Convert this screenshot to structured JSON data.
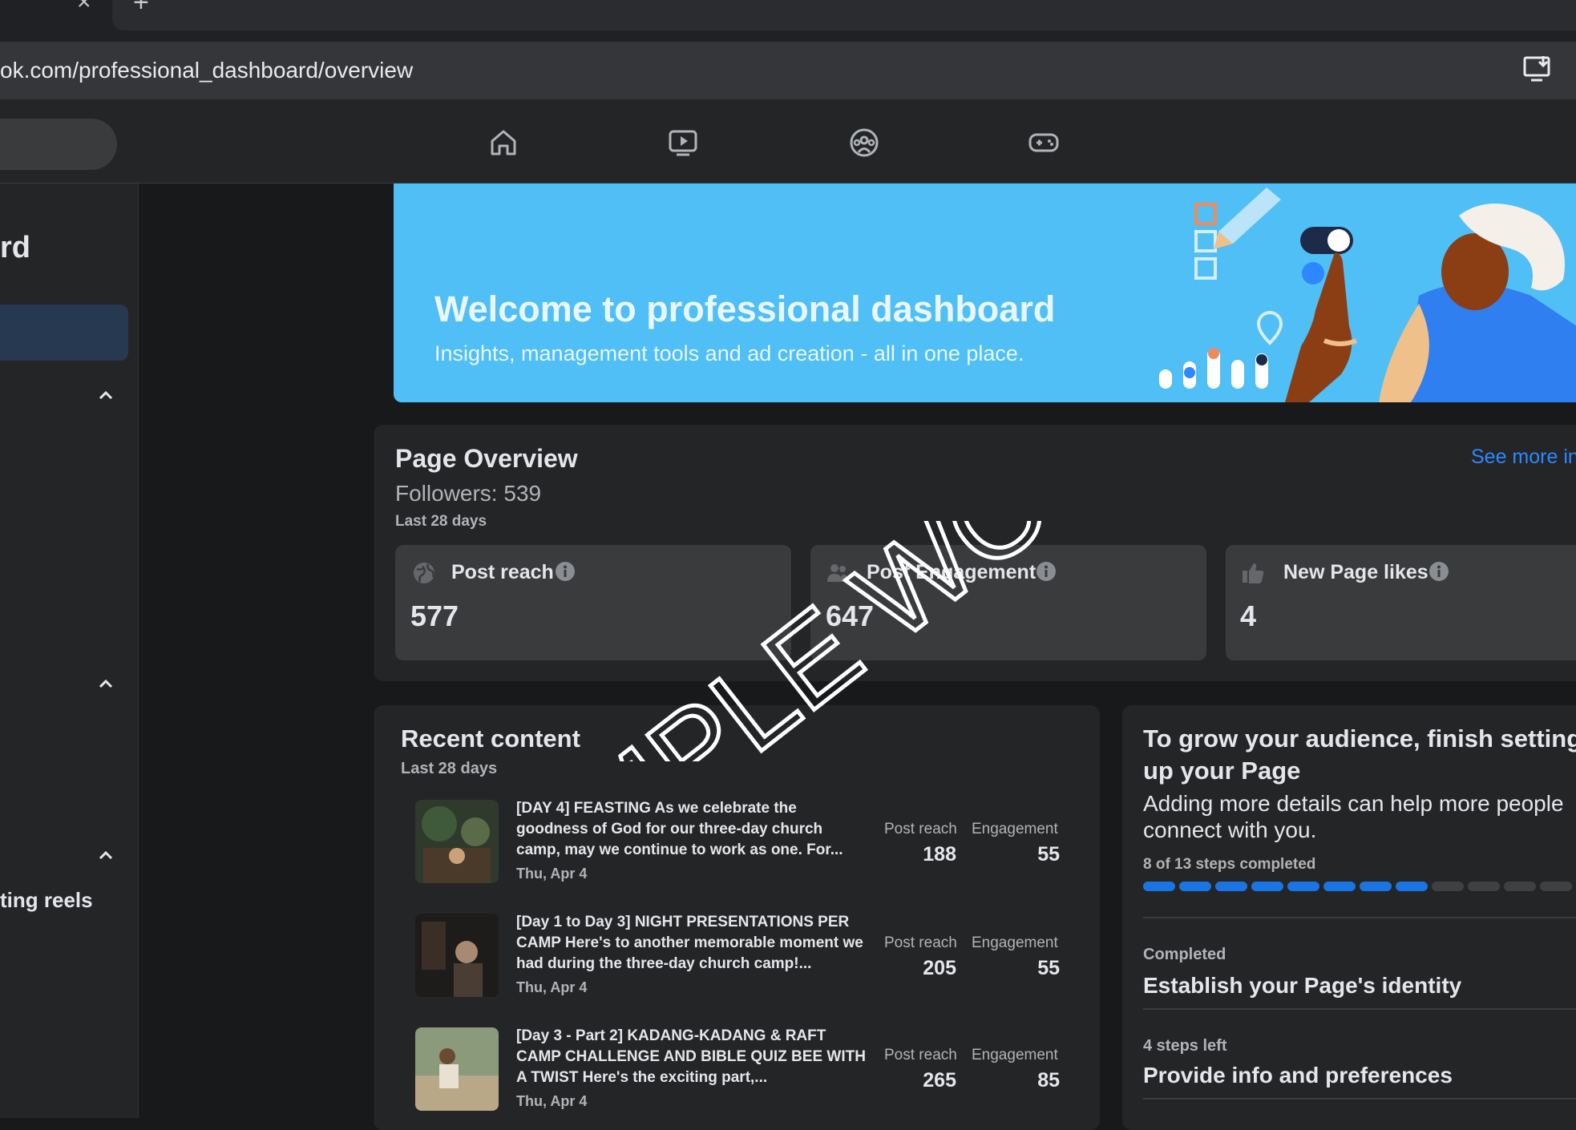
{
  "browser": {
    "tab_close": "×",
    "tab_new": "+",
    "url": "ok.com/professional_dashboard/overview"
  },
  "sidebar": {
    "title": "rd",
    "reels_item": "ting reels"
  },
  "banner": {
    "title": "Welcome to professional dashboard",
    "subtitle": "Insights, management tools and ad creation - all in one place."
  },
  "overview": {
    "title": "Page Overview",
    "followers": "Followers: 539",
    "range": "Last 28 days",
    "see_more": "See more in",
    "metrics": [
      {
        "label": "Post reach",
        "value": "577",
        "icon": "globe-icon"
      },
      {
        "label": "Post Engagement",
        "value": "647",
        "icon": "people-icon"
      },
      {
        "label": "New Page likes",
        "value": "4",
        "icon": "thumbs-up-icon"
      }
    ]
  },
  "recent": {
    "title": "Recent content",
    "range": "Last 28 days",
    "reach_label": "Post reach",
    "engagement_label": "Engagement",
    "posts": [
      {
        "text": "[DAY 4] FEASTING As we celebrate the goodness of God for our three-day church camp, may we continue to work as one. For...",
        "date": "Thu, Apr 4",
        "reach": "188",
        "engagement": "55"
      },
      {
        "text": "[Day 1 to Day 3] NIGHT PRESENTATIONS PER CAMP Here's to another memorable moment we had during the three-day church camp!...",
        "date": "Thu, Apr 4",
        "reach": "205",
        "engagement": "55"
      },
      {
        "text": "[Day 3 - Part 2] KADANG-KADANG & RAFT CAMP CHALLENGE AND BIBLE QUIZ BEE WITH A TWIST Here's the exciting part,...",
        "date": "Thu, Apr 4",
        "reach": "265",
        "engagement": "85"
      }
    ]
  },
  "grow": {
    "title": "To grow your audience, finish setting up your Page",
    "subtitle": "Adding more details can help more people connect with you.",
    "steps_text": "8 of 13 steps completed",
    "steps_completed": 8,
    "steps_total": 13,
    "completed_label": "Completed",
    "completed_item": "Establish your Page's identity",
    "left_label": "4 steps left",
    "left_item": "Provide info and preferences"
  },
  "watermark": "SAMPLE WORKS",
  "colors": {
    "background": "#18191a",
    "card": "#242526",
    "accent": "#2d88ff",
    "banner": "#50bff5",
    "progress_done": "#1b74e4",
    "progress_todo": "#3e4042"
  }
}
